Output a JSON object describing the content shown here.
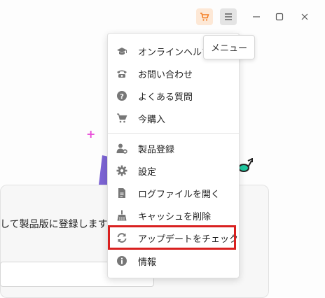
{
  "window": {
    "cart_icon": "cart-icon",
    "menu_icon": "hamburger-menu-icon",
    "minimize_icon": "minimize-icon",
    "maximize_icon": "maximize-icon",
    "close_icon": "close-icon",
    "cart_color": "#f47c20"
  },
  "tooltip": {
    "text": "メニュー"
  },
  "background": {
    "card_text": "して製品版に登録します"
  },
  "menu": {
    "items": [
      {
        "label": "オンラインヘルプ",
        "icon": "graduation-cap-icon"
      },
      {
        "label": "お問い合わせ",
        "icon": "phone-icon"
      },
      {
        "label": "よくある質問",
        "icon": "question-circle-icon"
      },
      {
        "label": "今購入",
        "icon": "cart-icon"
      },
      {
        "label": "製品登録",
        "icon": "user-add-icon"
      },
      {
        "label": "設定",
        "icon": "gear-icon"
      },
      {
        "label": "ログファイルを開く",
        "icon": "document-icon"
      },
      {
        "label": "キャッシュを削除",
        "icon": "broom-icon"
      },
      {
        "label": "アップデートをチェック",
        "icon": "refresh-icon"
      },
      {
        "label": "情報",
        "icon": "info-circle-icon"
      }
    ],
    "highlight_color": "#d9201f"
  }
}
